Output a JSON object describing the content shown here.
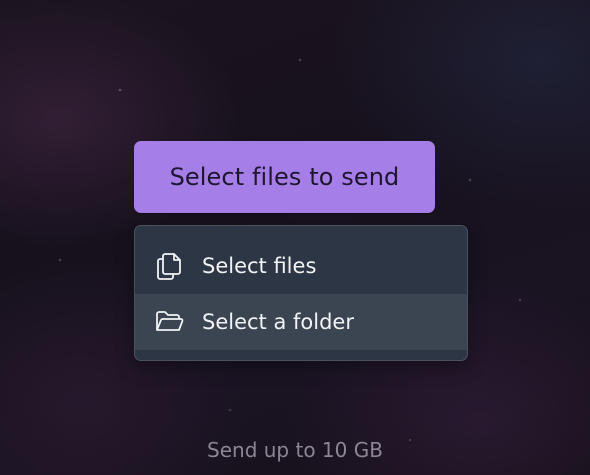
{
  "upload": {
    "primary_button_label": "Select files to send",
    "menu": {
      "items": [
        {
          "label": "Select files",
          "icon": "files-copy-icon"
        },
        {
          "label": "Select a folder",
          "icon": "folder-open-icon"
        }
      ]
    },
    "limit_note": "Send up to 10 GB"
  },
  "colors": {
    "primary_button_bg": "#a67ee8",
    "menu_bg": "#2d3644",
    "menu_item_highlight": "#3b4451",
    "note_text": "#8c8694"
  }
}
